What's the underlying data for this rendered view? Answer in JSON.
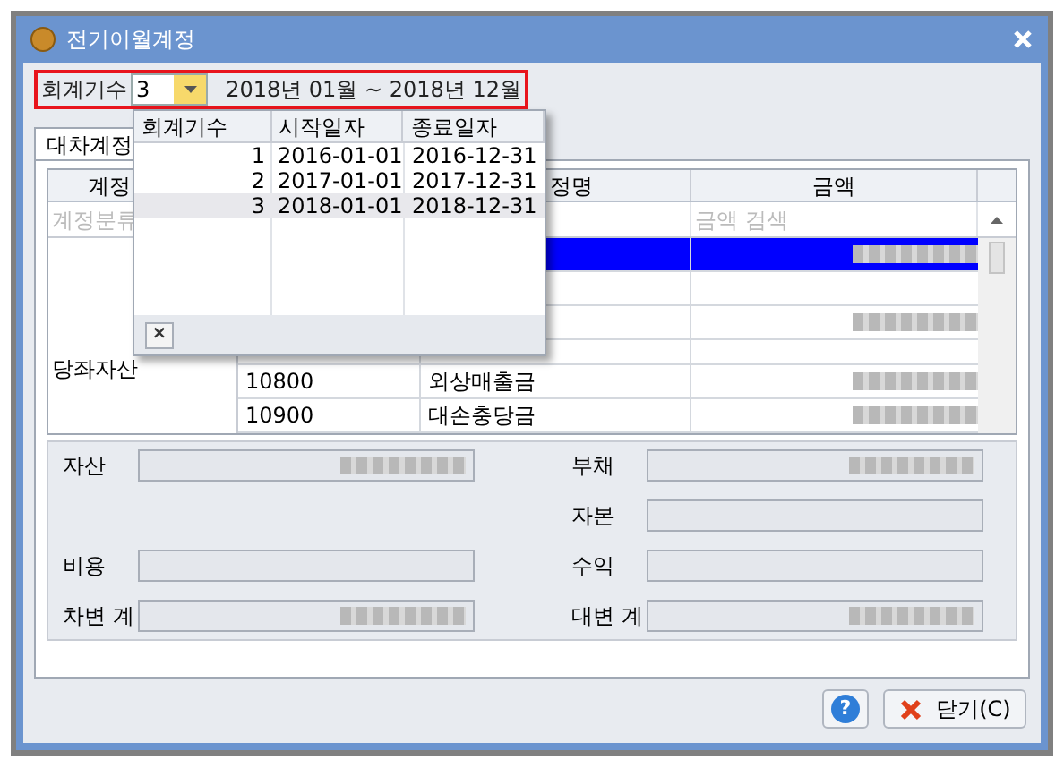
{
  "window": {
    "title": "전기이월계정"
  },
  "fiscal": {
    "label": "회계기수",
    "value": "3",
    "period": "2018년 01월 ~ 2018년 12월",
    "highlighted": true
  },
  "dropdown": {
    "columns": [
      "회계기수",
      "시작일자",
      "종료일자"
    ],
    "rows": [
      {
        "no": "1",
        "start": "2016-01-01",
        "end": "2016-12-31",
        "selected": false
      },
      {
        "no": "2",
        "start": "2017-01-01",
        "end": "2017-12-31",
        "selected": false
      },
      {
        "no": "3",
        "start": "2018-01-01",
        "end": "2018-12-31",
        "selected": true
      }
    ],
    "close_label": "×"
  },
  "tabs": [
    {
      "label": "대차계정",
      "selected": true
    }
  ],
  "grid": {
    "columns": {
      "column_1": "계정",
      "column_3": "정명",
      "column_4": "금액"
    },
    "filters": {
      "column_1": {
        "placeholder": "계정분류"
      },
      "column_4": {
        "placeholder": "금액 검색"
      }
    },
    "group": "당좌자산",
    "rows": [
      {
        "selected": true,
        "amount_masked": true
      },
      {
        "selected": false,
        "amount_masked": false
      },
      {
        "selected": false,
        "amount_masked": true
      },
      {
        "selected": false,
        "amount_masked": false
      },
      {
        "code": "10800",
        "name": "외상매출금",
        "selected": false,
        "amount_masked": true
      },
      {
        "code": "10900",
        "name": "대손충당금",
        "selected": false,
        "amount_masked": true
      }
    ]
  },
  "summary": [
    {
      "left": {
        "label": "자산",
        "masked": true
      },
      "right": {
        "label": "부채",
        "masked": true
      }
    },
    {
      "right": {
        "label": "자본",
        "masked": false
      }
    },
    {
      "left": {
        "label": "비용",
        "masked": false
      },
      "right": {
        "label": "수익",
        "masked": false
      }
    },
    {
      "left": {
        "label": "차변 계",
        "masked": true
      },
      "right": {
        "label": "대변 계",
        "masked": true
      }
    }
  ],
  "buttons": [
    {
      "kind": "help",
      "label": "?"
    },
    {
      "kind": "close",
      "label": "닫기(C)"
    }
  ]
}
